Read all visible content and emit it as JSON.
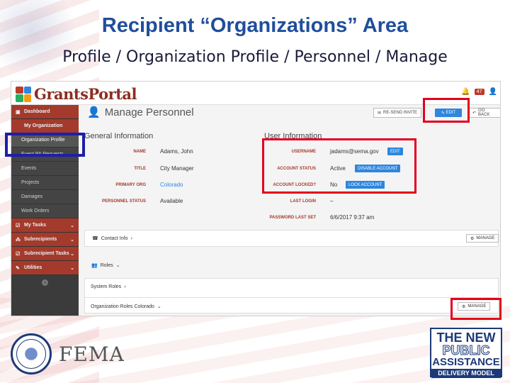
{
  "slide": {
    "title": "Recipient “Organizations” Area",
    "subtitle": "Profile / Organization Profile / Personnel / Manage"
  },
  "app": {
    "logo_text": "GrantsPortal",
    "notification_count": "47",
    "icons": [
      "bell-icon",
      "user-icon"
    ]
  },
  "sidebar": {
    "items": [
      {
        "label": "Dashboard",
        "icon": "dashboard-icon"
      },
      {
        "label": "My Organization",
        "icon": ""
      },
      {
        "label": "Organization Profile",
        "icon": ""
      },
      {
        "label": "Event PA Requests",
        "icon": ""
      },
      {
        "label": "Events",
        "icon": ""
      },
      {
        "label": "Projects",
        "icon": ""
      },
      {
        "label": "Damages",
        "icon": ""
      },
      {
        "label": "Work Orders",
        "icon": ""
      },
      {
        "label": "My Tasks",
        "icon": "check-icon"
      },
      {
        "label": "Subrecipients",
        "icon": "org-icon"
      },
      {
        "label": "Subrecipient Tasks",
        "icon": "check-icon"
      },
      {
        "label": "Utilities",
        "icon": "wrench-icon"
      }
    ]
  },
  "header": {
    "title": "Manage Personnel",
    "resend_label": "RE-SEND INVITE",
    "edit_label": "EDIT",
    "back_label": "GO BACK"
  },
  "general": {
    "heading": "General Information",
    "name_key": "NAME",
    "name_val": "Adams, John",
    "title_key": "TITLE",
    "title_val": "City Manager",
    "org_key": "PRIMARY ORG",
    "org_val": "Colorado",
    "status_key": "PERSONNEL STATUS",
    "status_val": "Available"
  },
  "user": {
    "heading": "User Information",
    "username_key": "USERNAME",
    "username_val": "jadams@sema.gov",
    "username_edit": "EDIT",
    "acct_status_key": "ACCOUNT STATUS",
    "acct_status_val": "Active",
    "disable_label": "DISABLE ACCOUNT",
    "locked_key": "ACCOUNT LOCKED?",
    "locked_val": "No",
    "lock_label": "LOCK ACCOUNT",
    "last_login_key": "LAST LOGIN",
    "last_login_val": "–",
    "pwd_key": "PASSWORD LAST SET",
    "pwd_val": "6/6/2017 9:37 am"
  },
  "contact": {
    "label": "Contact Info",
    "manage_label": "MANAGE"
  },
  "roles": {
    "label": "Roles",
    "system_roles": "System Roles",
    "org_roles": "Organization Roles Colorado",
    "manage_label": "MANAGE"
  },
  "footer": {
    "fema_text": "FEMA",
    "pa_line1": "THE NEW",
    "pa_line2": "PUBLIC",
    "pa_line3": "ASSISTANCE",
    "pa_line4": "DELIVERY MODEL"
  },
  "colors": {
    "title_blue": "#1f4e9c",
    "brand_red": "#a33a2c",
    "button_blue": "#2e86de",
    "highlight_red": "#e3001b",
    "highlight_blue": "#1e1ea8"
  }
}
